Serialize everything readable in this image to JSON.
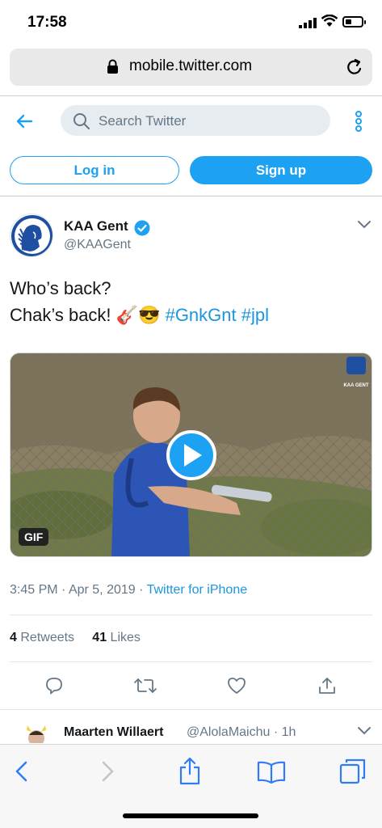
{
  "status_bar": {
    "time": "17:58"
  },
  "browser": {
    "url": "mobile.twitter.com"
  },
  "header": {
    "search_placeholder": "Search Twitter",
    "login_label": "Log in",
    "signup_label": "Sign up"
  },
  "tweet": {
    "author_name": "KAA Gent",
    "author_handle": "@KAAGent",
    "line1": "Who’s back?",
    "line2_prefix": "Chak’s back! ",
    "emojis": "🎸😎",
    "hashtag1": "#GnkGnt",
    "hashtag2": "#jpl",
    "media_badge": "GIF",
    "watermark": "KAA GENT",
    "time": "3:45 PM",
    "date": "Apr 5, 2019",
    "source": "Twitter for iPhone",
    "retweets_count": "4",
    "retweets_label": "Retweets",
    "likes_count": "41",
    "likes_label": "Likes"
  },
  "reply": {
    "name": "Maarten Willaert",
    "handle": "@AlolaMaichu · 1h"
  },
  "colors": {
    "twitter_blue": "#1da1f2",
    "link_blue": "#1b95e0",
    "ios_blue": "#2f7cf6",
    "gray": "#657786"
  },
  "icons": [
    "signal-icon",
    "wifi-icon",
    "battery-icon",
    "lock-icon",
    "reload-icon",
    "back-arrow-icon",
    "search-icon",
    "more-icon",
    "verified-icon",
    "chevron-down-icon",
    "play-icon",
    "reply-icon",
    "retweet-icon",
    "like-icon",
    "share-icon",
    "safari-back-icon",
    "safari-forward-icon",
    "safari-share-icon",
    "bookmarks-icon",
    "tabs-icon"
  ]
}
